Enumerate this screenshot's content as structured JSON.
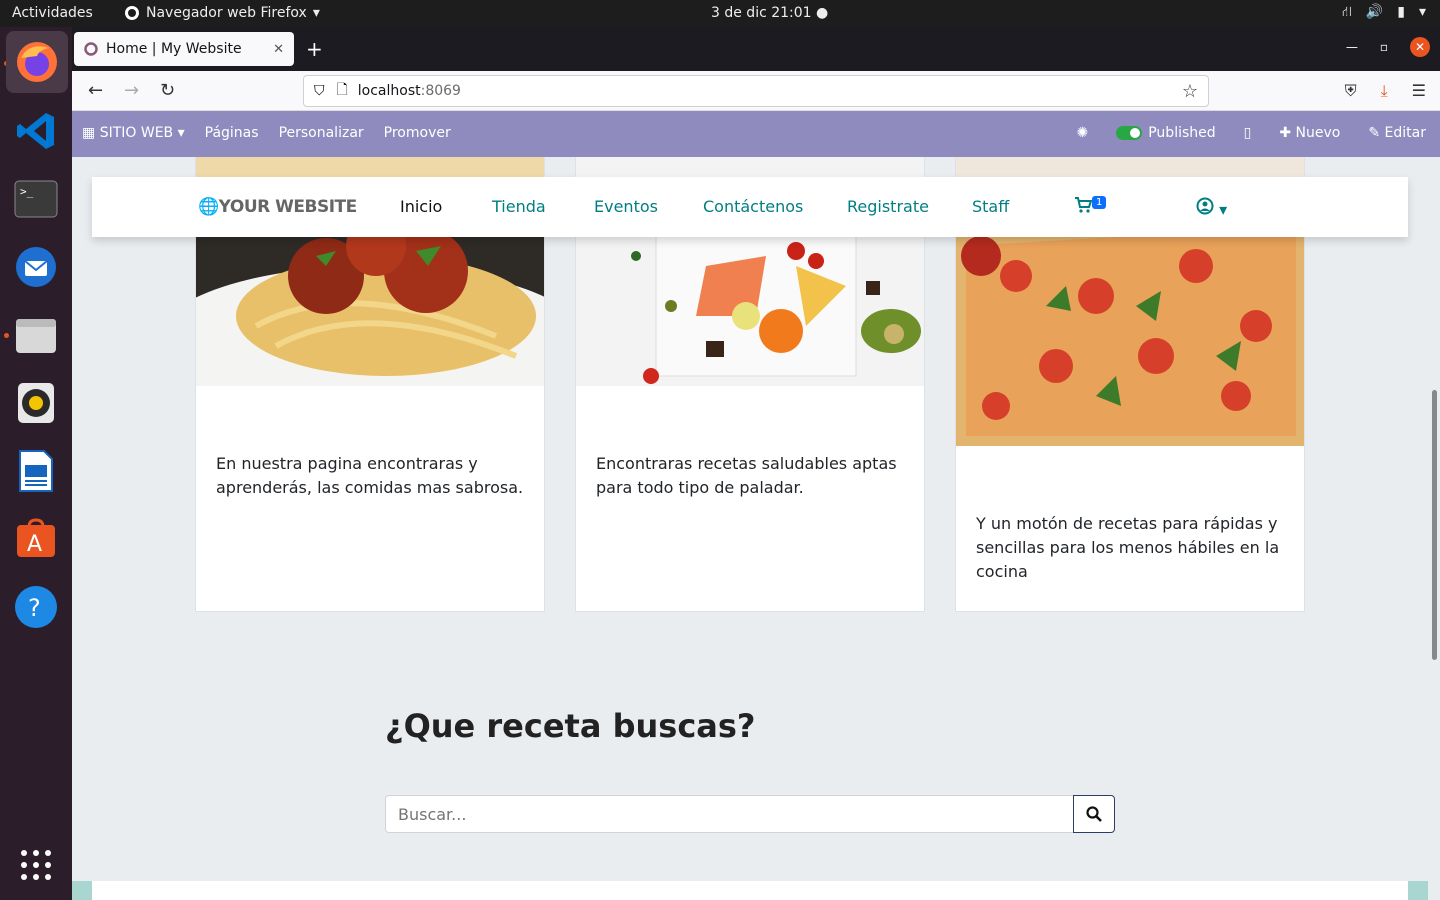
{
  "topbar": {
    "activities": "Actividades",
    "app_name": "Navegador web Firefox",
    "clock": "3 de dic  21:01"
  },
  "dock": {
    "items": [
      "firefox-icon",
      "vscode-icon",
      "terminal-icon",
      "thunderbird-icon",
      "files-icon",
      "rhythmbox-icon",
      "writer-icon",
      "software-icon",
      "help-icon",
      "apps-grid-icon"
    ]
  },
  "browser": {
    "tab_title": "Home | My Website",
    "url_host": "localhost",
    "url_port": ":8069"
  },
  "odoo": {
    "menu_site": "SITIO WEB",
    "menu_pages": "Páginas",
    "menu_customize": "Personalizar",
    "menu_promote": "Promover",
    "published": "Published",
    "new": "Nuevo",
    "edit": "Editar"
  },
  "site": {
    "logo": "YOUR WEBSITE",
    "menu": [
      "Inicio",
      "Tienda",
      "Eventos",
      "Contáctenos",
      "Registrate",
      "Staff"
    ],
    "cart_count": "1"
  },
  "cards": [
    {
      "text": "En nuestra pagina encontraras  y aprenderás, las comidas mas sabrosa."
    },
    {
      "text": "Encontraras recetas saludables aptas para todo tipo de paladar."
    },
    {
      "text": "Y un motón de recetas para rápidas y sencillas para los menos hábiles en la cocina"
    }
  ],
  "search": {
    "title": "¿Que receta buscas?",
    "placeholder": "Buscar..."
  },
  "colors": {
    "odoo_bar": "#8f8bbf",
    "link": "#017e84",
    "published_toggle": "#28a745",
    "ubuntu_orange": "#e95420"
  }
}
